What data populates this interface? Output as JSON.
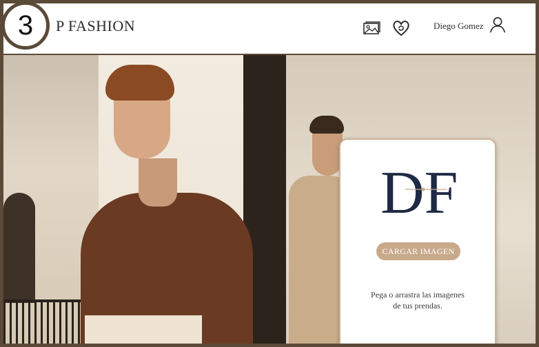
{
  "step_badge": "3",
  "brand": "P FASHION",
  "header": {
    "icons": [
      "gallery-icon",
      "heart-icon",
      "user-icon"
    ],
    "user_name": "Diego Gomez"
  },
  "upload_card": {
    "logo_text": "DF",
    "button_label": "CARGAR IMAGEN",
    "hint_line1": "Pega o arrastra las imagenes",
    "hint_line2": "de tus prendas."
  },
  "colors": {
    "frame": "#5b4a37",
    "accent": "#c8a98a",
    "logo": "#1f2a44"
  }
}
